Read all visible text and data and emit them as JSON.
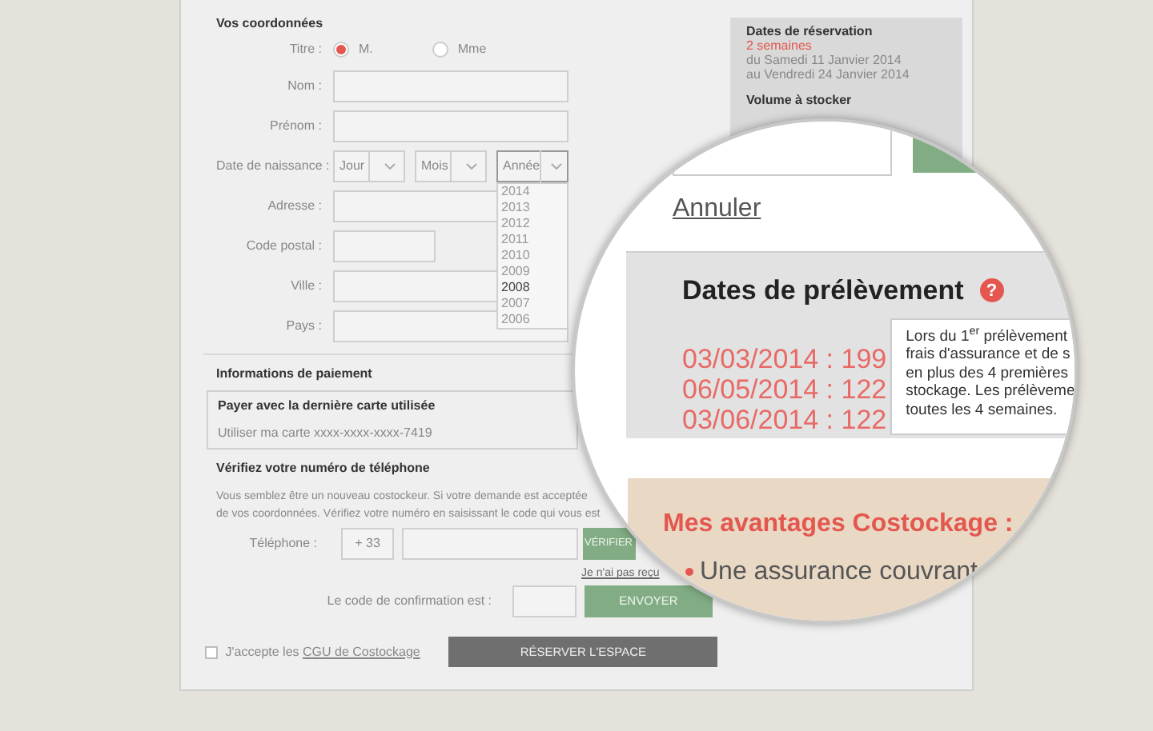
{
  "personal": {
    "heading": "Vos coordonnées",
    "title_field": {
      "label": "Titre :",
      "options": [
        {
          "label": "M.",
          "selected": true
        },
        {
          "label": "Mme",
          "selected": false
        }
      ]
    },
    "fields": [
      {
        "kind": "text",
        "label": "Nom :"
      },
      {
        "kind": "text",
        "label": "Prénom :"
      },
      {
        "kind": "date",
        "label": "Date de naissance :",
        "selects": [
          {
            "value": "Jour",
            "expanded": false
          },
          {
            "value": "Mois",
            "expanded": false
          },
          {
            "value": "Année",
            "expanded": true,
            "options": [
              {
                "label": "2014",
                "selected": false
              },
              {
                "label": "2013",
                "selected": false
              },
              {
                "label": "2012",
                "selected": false
              },
              {
                "label": "2011",
                "selected": false
              },
              {
                "label": "2010",
                "selected": false
              },
              {
                "label": "2009",
                "selected": false
              },
              {
                "label": "2008",
                "selected": true
              },
              {
                "label": "2007",
                "selected": false
              },
              {
                "label": "2006",
                "selected": false
              }
            ]
          }
        ]
      },
      {
        "kind": "text",
        "label": "Adresse :"
      },
      {
        "kind": "short",
        "label": "Code postal :"
      },
      {
        "kind": "text",
        "label": "Ville :"
      },
      {
        "kind": "text",
        "label": "Pays :"
      }
    ]
  },
  "payment": {
    "heading": "Informations de paiement",
    "card_title": "Payer avec la dernière carte utilisée",
    "card_text": "Utiliser ma carte xxxx-xxxx-xxxx-7419"
  },
  "phone": {
    "heading": "Vérifiez votre numéro de téléphone",
    "paragraph": [
      "Vous semblez être un nouveau costockeur. Si votre demande est acceptée",
      "de vos coordonnées. Vérifiez votre numéro  en saisissant le code qui vous est"
    ],
    "phone_label": "Téléphone :",
    "prefix": "+ 33",
    "verify_button": "VÉRIFIER",
    "resend_link": "Je n'ai pas reçu",
    "code_label": "Le code de confirmation est :",
    "send_button": "ENVOYER"
  },
  "terms": {
    "checked": false,
    "text": "J'accepte les",
    "link": "CGU de Costockage"
  },
  "reserve_button": "RÉSERVER L'ESPACE",
  "summary": {
    "heading": "Dates de réservation",
    "duration": "2 semaines",
    "from": "du Samedi 11 Janvier 2014",
    "to": "au Vendredi 24 Janvier 2014",
    "volume_heading": "Volume à stocker"
  },
  "magnifier": {
    "cancel_link": "Annuler",
    "withdrawal": {
      "title": "Dates de prélèvement",
      "help_icon": "?",
      "dates": [
        "03/03/2014 : 199",
        "06/05/2014 : 122",
        "03/06/2014 : 122"
      ],
      "tooltip_lines": [
        "Lors du 1$^{er}$ prélèvement",
        "frais d'assurance et de s",
        "en plus des 4 premières",
        "stockage. Les prélèveme",
        "toutes les 4 semaines."
      ]
    },
    "advantages": {
      "title": "Mes avantages Costockage :",
      "items": [
        "Une assurance couvrant"
      ]
    }
  }
}
